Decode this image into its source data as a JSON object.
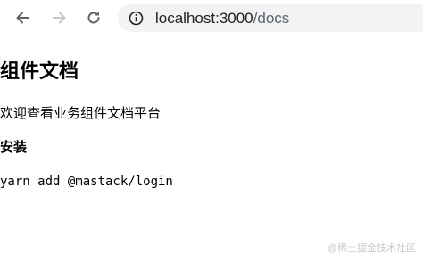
{
  "browser": {
    "url_host": "localhost:3000",
    "url_path": "/docs",
    "icons": {
      "back": "arrow-left-icon",
      "forward": "arrow-right-icon",
      "reload": "reload-icon",
      "site_info": "info-icon"
    }
  },
  "page": {
    "title": "组件文档",
    "intro": "欢迎查看业务组件文档平台",
    "install_heading": "安装",
    "install_command": "yarn add @mastack/login"
  },
  "watermark": "@稀土掘金技术社区",
  "colors": {
    "toolbar_icon": "#5f6368",
    "toolbar_icon_disabled": "#c4c7c5",
    "omnibox_bg": "#f1f3f4"
  }
}
